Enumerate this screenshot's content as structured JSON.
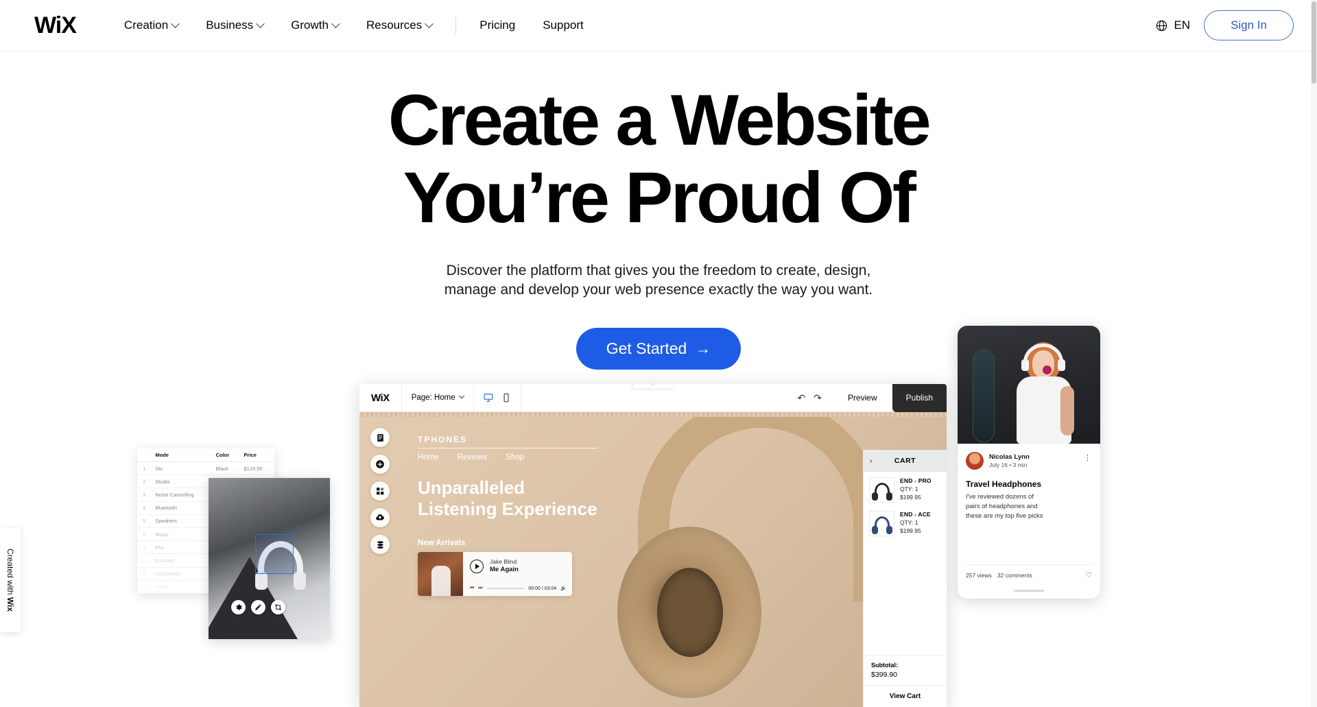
{
  "header": {
    "logo": "WiX",
    "nav": [
      {
        "label": "Creation",
        "has_chevron": true
      },
      {
        "label": "Business",
        "has_chevron": true
      },
      {
        "label": "Growth",
        "has_chevron": true
      },
      {
        "label": "Resources",
        "has_chevron": true
      },
      {
        "label": "Pricing",
        "has_chevron": false
      },
      {
        "label": "Support",
        "has_chevron": false
      }
    ],
    "language": "EN",
    "sign_in": "Sign In"
  },
  "hero": {
    "title_line1": "Create a Website",
    "title_line2": "You’re Proud Of",
    "subtitle_line1": "Discover the platform that gives you the freedom to create, design,",
    "subtitle_line2": "manage and develop your web presence exactly the way you want.",
    "cta_label": "Get Started",
    "cta_arrow": "→",
    "cta_color": "#1f5ce6"
  },
  "table_panel": {
    "columns": [
      "",
      "Mode",
      "Color",
      "Price"
    ],
    "rows": [
      {
        "idx": "1",
        "mode": "Ski",
        "color": "Black",
        "price": "$129.95"
      },
      {
        "idx": "2",
        "mode": "Studio",
        "color": "",
        "price": ""
      },
      {
        "idx": "3",
        "mode": "Noise Cancelling",
        "color": "",
        "price": ""
      },
      {
        "idx": "4",
        "mode": "Bluetooth",
        "color": "",
        "price": ""
      },
      {
        "idx": "5",
        "mode": "Speakers",
        "color": "",
        "price": ""
      },
      {
        "idx": "6",
        "mode": "Music",
        "color": "",
        "price": ""
      },
      {
        "idx": "7",
        "mode": "Pro",
        "color": "",
        "price": ""
      },
      {
        "idx": "8",
        "mode": "Earbuds",
        "color": "",
        "price": ""
      },
      {
        "idx": "9",
        "mode": "Lightweight",
        "color": "",
        "price": ""
      },
      {
        "idx": "10",
        "mode": "In-Ear",
        "color": "",
        "price": ""
      }
    ],
    "edit_tools": [
      "settings-icon",
      "pencil-icon",
      "crop-icon"
    ]
  },
  "editor": {
    "logo": "WiX",
    "page_selector": "Page: Home",
    "device_desktop": "desktop-icon",
    "device_mobile": "mobile-icon",
    "undo": "↶",
    "redo": "↷",
    "preview": "Preview",
    "publish": "Publish",
    "rail_icons": [
      "pages-icon",
      "add-icon",
      "apps-icon",
      "upload-icon",
      "database-icon"
    ],
    "site": {
      "brand": "TPHONES",
      "nav": [
        "Home",
        "Reviews",
        "Shop"
      ],
      "heading_line1": "Unparalleled",
      "heading_line2": "Listening Experience",
      "section_label": "New Arrivals",
      "player": {
        "artist": "Jake Blind",
        "track": "Me Again",
        "time": "00:00 / 03:04",
        "prev": "⏮",
        "next": "⏭",
        "volume": "🔊"
      }
    },
    "cart": {
      "title": "CART",
      "collapse": "›",
      "items": [
        {
          "name": "END - PRO",
          "qty": "QTY: 1",
          "price": "$199.95"
        },
        {
          "name": "END - ACE",
          "qty": "QTY: 1",
          "price": "$199.95"
        }
      ],
      "subtotal_label": "Subtotal:",
      "subtotal_value": "$399.90",
      "view_cart": "View Cart"
    }
  },
  "phone": {
    "author": "Nicolas Lynn",
    "date": "July 16 • 3 min",
    "menu": "⋮",
    "post_title": "Travel Headphones",
    "excerpt_l1": "I've reviewed dozens of",
    "excerpt_l2": "pairs of headphones and",
    "excerpt_l3": "these are my top five picks",
    "views": "257 views",
    "comments": "32 comments",
    "like": "♡"
  },
  "badge": {
    "prefix": "Created with ",
    "brand": "Wix"
  }
}
